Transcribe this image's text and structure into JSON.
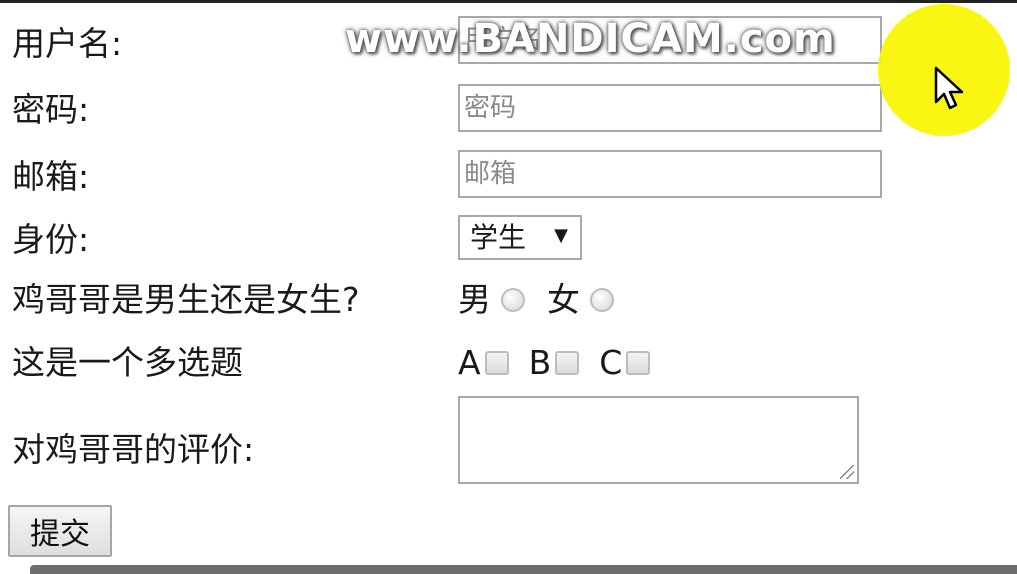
{
  "form": {
    "username": {
      "label": "用户名:",
      "placeholder": "用户名"
    },
    "password": {
      "label": "密码:",
      "placeholder": "密码"
    },
    "email": {
      "label": "邮箱:",
      "placeholder": "邮箱"
    },
    "identity": {
      "label": "身份:",
      "selected": "学生"
    },
    "gender": {
      "question": "鸡哥哥是男生还是女生?",
      "options": [
        "男",
        "女"
      ]
    },
    "multi": {
      "question": "这是一个多选题",
      "options": [
        "A",
        "B",
        "C"
      ]
    },
    "comment": {
      "label": "对鸡哥哥的评价:",
      "value": ""
    },
    "submit_label": "提交"
  },
  "overlay": {
    "watermark": "www.BANDICAM.com",
    "cursor_highlight_color": "#f8f500"
  }
}
